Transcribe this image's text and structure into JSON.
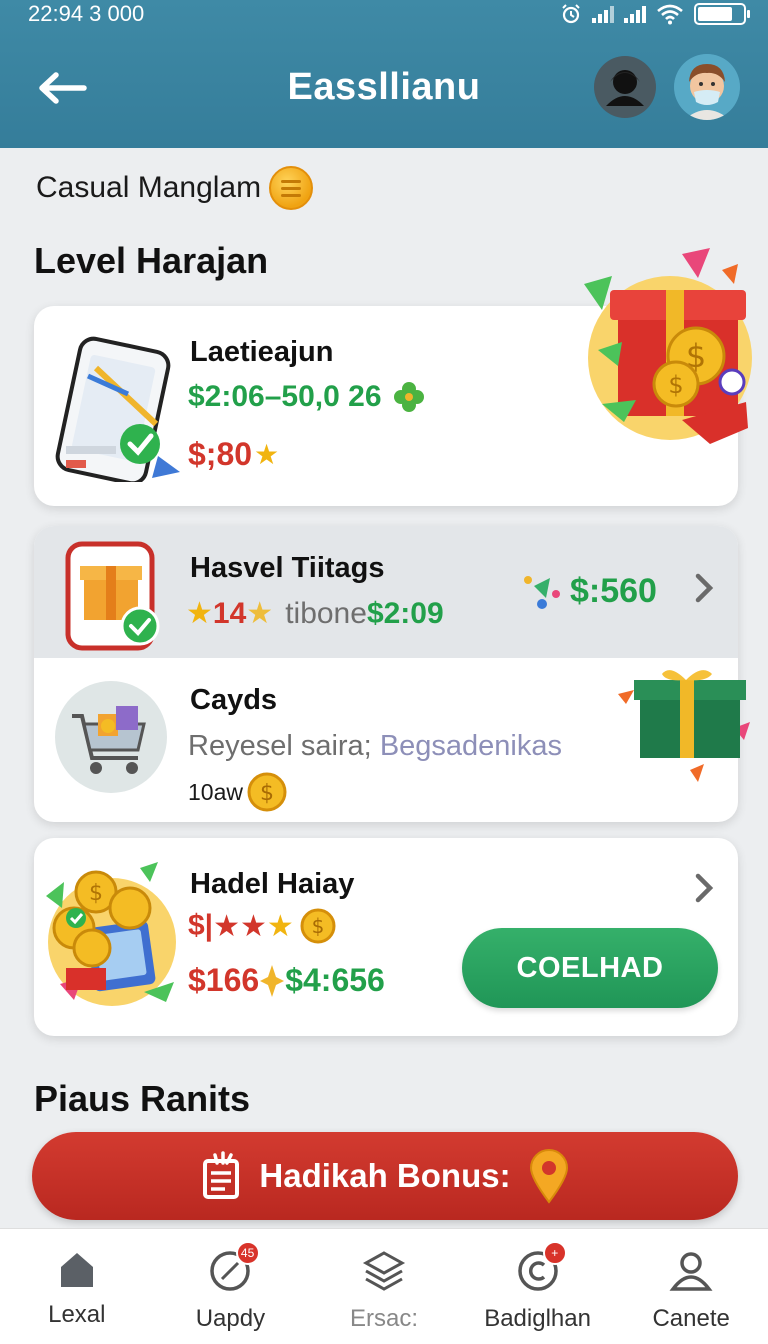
{
  "status_bar": {
    "time": "22:94 3  000"
  },
  "header": {
    "title": "Eassllianu"
  },
  "subtitle": "Casual Manglam",
  "sections": {
    "level": "Level Harajan",
    "bonus": "Piaus Ranits"
  },
  "cards": [
    {
      "title": "Laetieajun",
      "line1": "$2:06–50,0 26",
      "line2": "$;80"
    },
    {
      "title": "Hasvel Tiitags",
      "stars_value": "14",
      "sub_text": "tibone",
      "sub_value": "$2:09",
      "right_value": "$:560"
    },
    {
      "title": "Cayds",
      "desc_a": "Reyesel saira;",
      "desc_b": "Begsadenikas",
      "meta": "10aw"
    },
    {
      "title": "Hadel Haiay",
      "rating_prefix": "$|",
      "value_red": "$166",
      "value_green": "$4:656",
      "button": "COELHAD"
    }
  ],
  "bonus_button": "Hadikah Bonus:",
  "bottom_nav": [
    {
      "label": "Lexal",
      "icon": "home-icon"
    },
    {
      "label": "Uapdy",
      "icon": "compass-icon",
      "badge": "45"
    },
    {
      "label": "Ersac:",
      "icon": "layers-icon"
    },
    {
      "label": "Badiglhan",
      "icon": "copyright-icon",
      "badge": "+"
    },
    {
      "label": "Canete",
      "icon": "profile-icon"
    }
  ],
  "colors": {
    "header": "#3f8aa6",
    "accent_green": "#22a04a",
    "accent_red": "#d2362b",
    "star": "#f1b410"
  }
}
